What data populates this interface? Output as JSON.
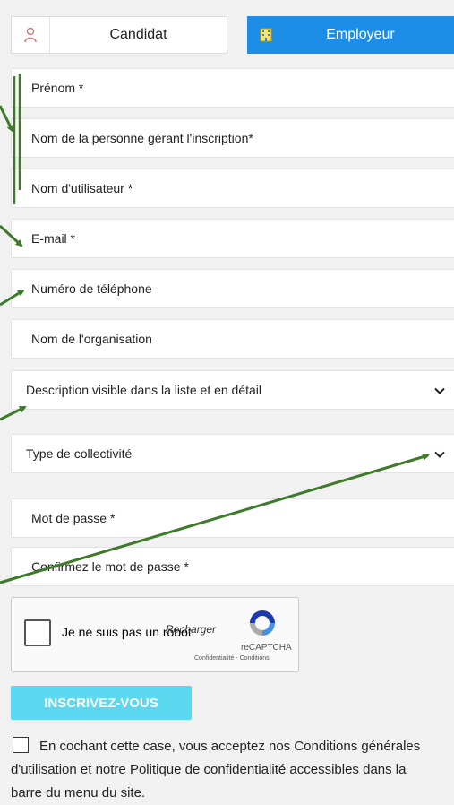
{
  "tabs": {
    "candidat": "Candidat",
    "employeur": "Employeur"
  },
  "fields": {
    "prenom": "Prénom *",
    "nom_gerant": "Nom de la personne gérant l'inscription*",
    "username": "Nom d'utilisateur *",
    "email": "E-mail *",
    "phone": "Numéro de téléphone",
    "organisation": "Nom de l'organisation",
    "description": "Description visible dans la liste et en détail",
    "collectivite": "Type de collectivité",
    "password": "Mot de passe *",
    "confirm_password": "Confirmez le mot de passe *"
  },
  "captcha": {
    "label": "Je ne suis pas un robot",
    "reload": "Recharger",
    "brand": "reCAPTCHA",
    "links": "Confidentialité - Conditions"
  },
  "submit_label": "INSCRIVEZ-VOUS",
  "consent": {
    "line1": "En cochant cette case, vous acceptez nos Conditions générales",
    "line2": "d'utilisation et notre Politique de confidentialité accessibles dans la",
    "line3": "barre du menu du site."
  },
  "colors": {
    "accent": "#1d8ee8",
    "submit": "#5bd8f0",
    "annotation": "#3d7a2a"
  }
}
